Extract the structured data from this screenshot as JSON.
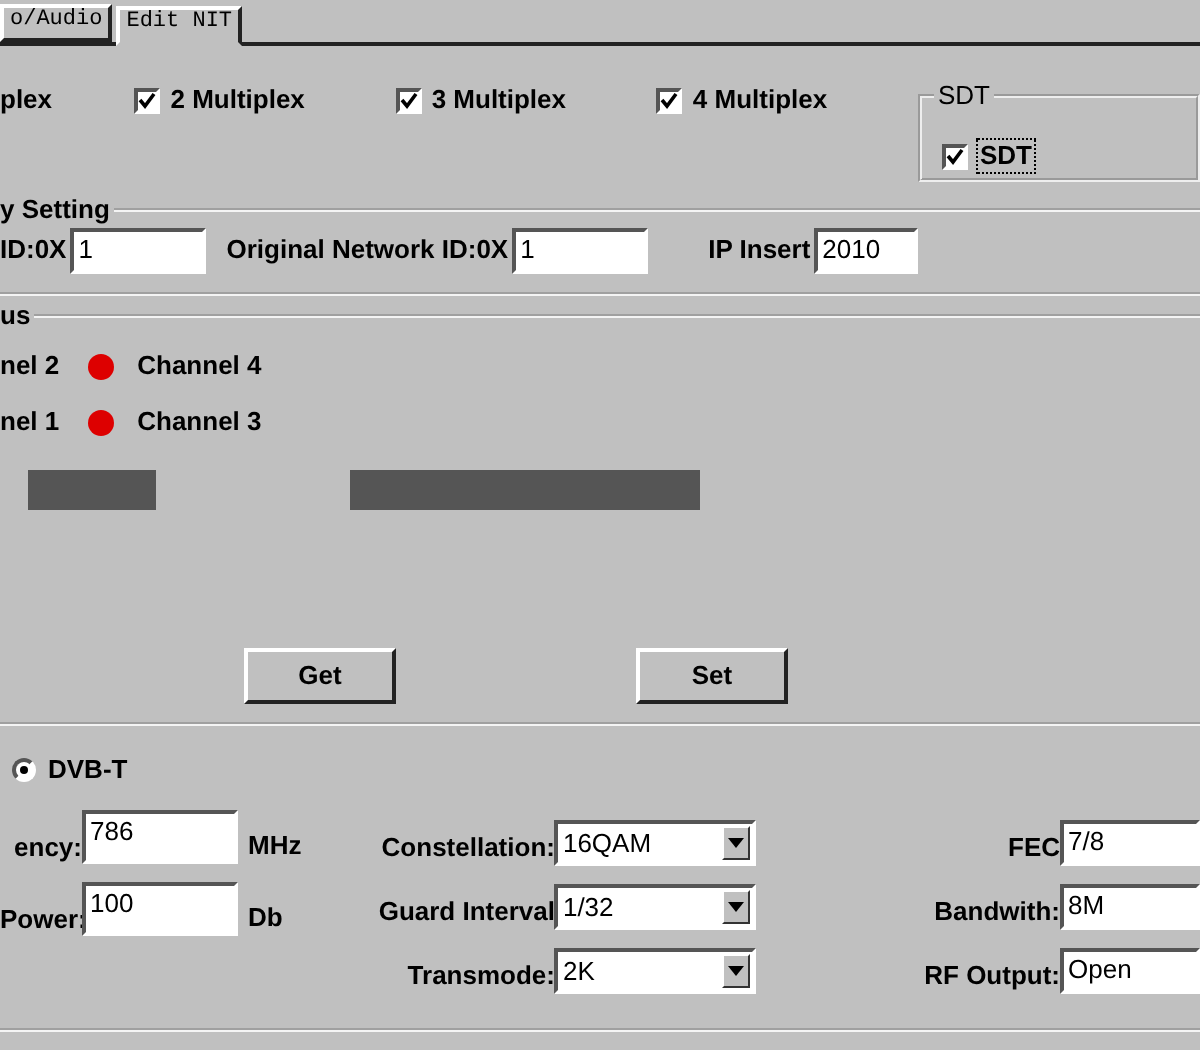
{
  "tabs": [
    {
      "label": "o/Audio",
      "selected": false
    },
    {
      "label": "Edit NIT",
      "selected": true
    }
  ],
  "multiplex": {
    "partial_label": "plex",
    "items": [
      {
        "label": "2 Multiplex",
        "checked": true
      },
      {
        "label": "3 Multiplex",
        "checked": true
      },
      {
        "label": "4 Multiplex",
        "checked": true
      }
    ]
  },
  "sdt_group": {
    "title": "SDT",
    "checkbox": {
      "label": "SDT",
      "checked": true
    }
  },
  "network_setting": {
    "title": "y Setting",
    "fields": [
      {
        "label": "ID:0X",
        "value": "1"
      },
      {
        "label": "Original Network ID:0X",
        "value": "1"
      },
      {
        "label": "IP Insert",
        "value": "2010"
      }
    ]
  },
  "status": {
    "title": "us",
    "rows": [
      [
        {
          "label": "nel 2"
        },
        {
          "label": "Channel 4",
          "color": "#dd0000"
        }
      ],
      [
        {
          "label": "nel 1"
        },
        {
          "label": "Channel 3",
          "color": "#dd0000"
        }
      ]
    ]
  },
  "buttons": [
    "Get",
    "Set"
  ],
  "rf": {
    "mode": {
      "label": "DVB-T",
      "selected": true
    },
    "left_fields": [
      {
        "label": "ency:",
        "value": "786",
        "unit": "MHz"
      },
      {
        "label": "Power:",
        "value": "100",
        "unit": "Db"
      }
    ],
    "combos": [
      {
        "label": "Constellation:",
        "value": "16QAM"
      },
      {
        "label": "Guard Interval",
        "value": "1/32"
      },
      {
        "label": "Transmode:",
        "value": "2K"
      }
    ],
    "right_fields": [
      {
        "label": "FEC",
        "value": "7/8"
      },
      {
        "label": "Bandwith:",
        "value": "8M"
      },
      {
        "label": "RF Output:",
        "value": "Open"
      }
    ]
  }
}
